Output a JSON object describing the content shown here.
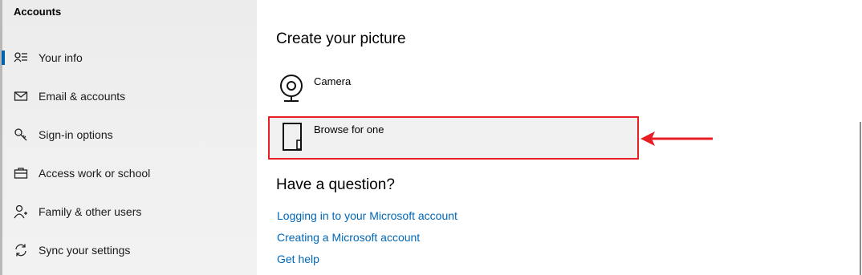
{
  "sidebar": {
    "title": "Accounts",
    "items": [
      {
        "label": "Your info",
        "icon": "person-list-icon",
        "selected": true
      },
      {
        "label": "Email & accounts",
        "icon": "mail-icon"
      },
      {
        "label": "Sign-in options",
        "icon": "key-icon"
      },
      {
        "label": "Access work or school",
        "icon": "briefcase-icon"
      },
      {
        "label": "Family & other users",
        "icon": "person-add-icon"
      },
      {
        "label": "Sync your settings",
        "icon": "sync-icon"
      }
    ]
  },
  "main": {
    "create_heading": "Create your picture",
    "options": [
      {
        "label": "Camera",
        "icon": "camera-icon"
      },
      {
        "label": "Browse for one",
        "icon": "browse-icon"
      }
    ],
    "question_heading": "Have a question?",
    "links": [
      "Logging in to your Microsoft account",
      "Creating a Microsoft account",
      "Get help"
    ]
  },
  "colors": {
    "accent": "#0063b1",
    "link": "#0067b8",
    "annotation_red": "#e81e25"
  }
}
